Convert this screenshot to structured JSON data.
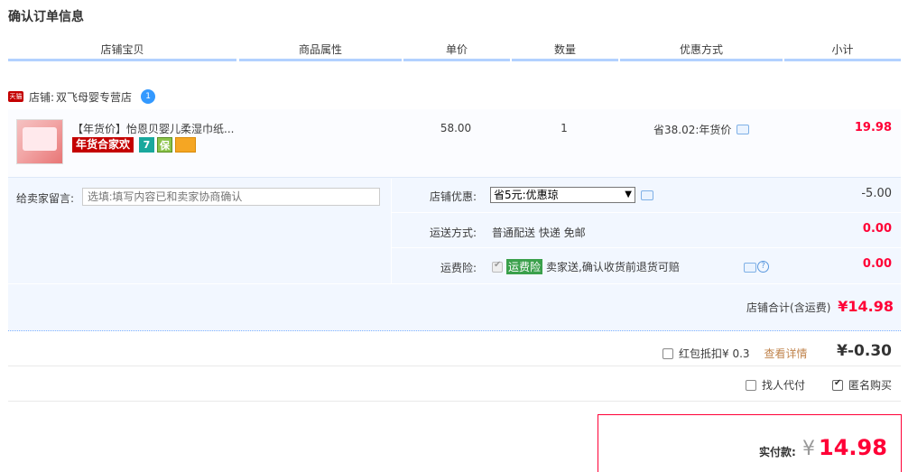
{
  "page_title": "确认订单信息",
  "columns": [
    "店铺宝贝",
    "商品属性",
    "单价",
    "数量",
    "优惠方式",
    "小计"
  ],
  "shop": {
    "badge": "天猫",
    "label": "店铺:",
    "name": "双飞母婴专营店",
    "chat_icon_text": "1"
  },
  "item": {
    "name": "【年货价】怡恩贝婴儿柔湿巾纸...",
    "promo_tag": "年货合家欢",
    "icon_1": "7",
    "icon_2": "保",
    "price": "58.00",
    "quantity": "1",
    "discount": "省38.02:年货价",
    "subtotal": "19.98"
  },
  "message": {
    "label": "给卖家留言:",
    "placeholder": "选填:填写内容已和卖家协商确认"
  },
  "shop_discount": {
    "label": "店铺优惠:",
    "selected": "省5元:优惠琼",
    "amount": "-5.00"
  },
  "shipping": {
    "label": "运送方式:",
    "value": "普通配送 快递 免邮",
    "amount": "0.00"
  },
  "insurance": {
    "label": "运费险:",
    "tag": "运费险",
    "desc": "卖家送,确认收货前退货可赔",
    "help": "?",
    "amount": "0.00"
  },
  "shop_total": {
    "label": "店铺合计(含运费)",
    "amount": "¥14.98"
  },
  "red_packet": {
    "label": "红包抵扣¥ 0.3",
    "detail_link": "查看详情",
    "amount": "¥-0.30"
  },
  "options": {
    "proxy_label": "找人代付",
    "anonymous_label": "匿名购买"
  },
  "payment": {
    "label": "实付款:",
    "currency": "¥",
    "amount": "14.98"
  },
  "colors": {
    "accent_red": "#ff0036",
    "header_line": "#b2d1ff",
    "panel_bg": "#f2f7ff",
    "tmall_red": "#c40000"
  }
}
